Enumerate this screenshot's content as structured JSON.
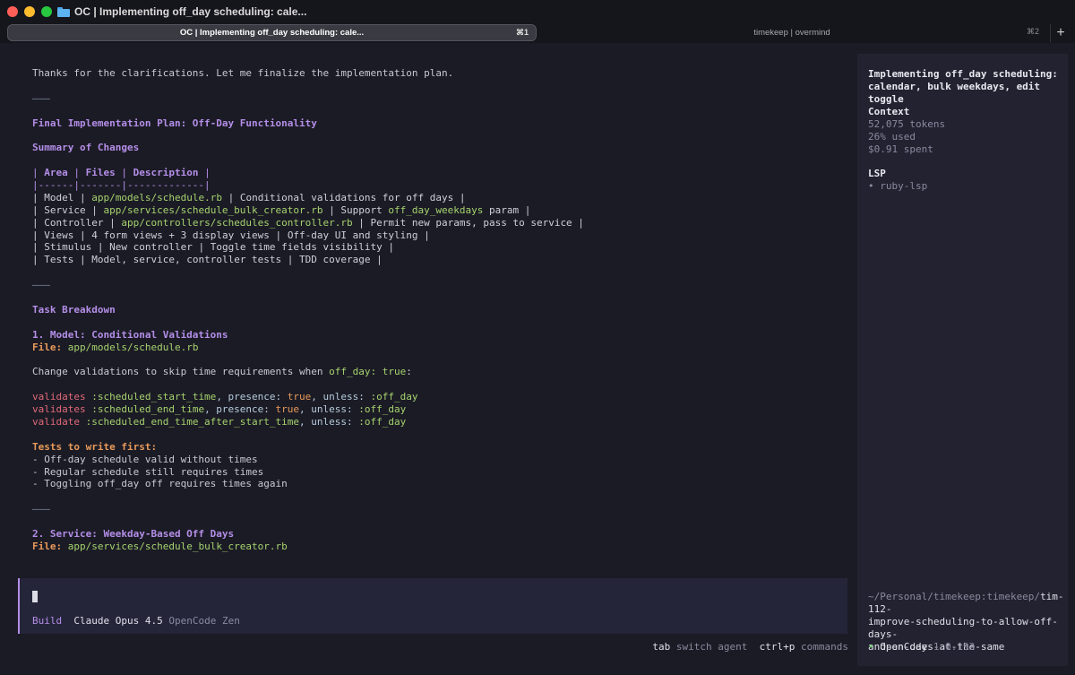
{
  "window": {
    "title": "OC | Implementing off_day scheduling: cale..."
  },
  "tabs": [
    {
      "label": "OC | Implementing off_day scheduling: cale...",
      "shortcut": "⌘1"
    },
    {
      "label": "timekeep | overmind",
      "shortcut": "⌘2"
    }
  ],
  "new_tab_label": "+",
  "conversation": {
    "intro": "Thanks for the clarifications. Let me finalize the implementation plan.",
    "rule": "———",
    "plan_title": "Final Implementation Plan: Off-Day Functionality",
    "summary_heading": "Summary of Changes",
    "table_header": {
      "pipe": "|",
      "cols": [
        "Area",
        "Files",
        "Description"
      ]
    },
    "table_separator": "|------|-------|-------------|",
    "table_rows": [
      {
        "area": "Model",
        "files": "app/models/schedule.rb",
        "desc_pre": "Conditional validations for off days",
        "desc_code": "",
        "desc_post": ""
      },
      {
        "area": "Service",
        "files": "app/services/schedule_bulk_creator.rb",
        "desc_pre": "Support ",
        "desc_code": "off_day_weekdays",
        "desc_post": " param"
      },
      {
        "area": "Controller",
        "files": "app/controllers/schedules_controller.rb",
        "desc_pre": "Permit new params, pass to service",
        "desc_code": "",
        "desc_post": ""
      },
      {
        "area": "Views",
        "files": "4 form views + 3 display views",
        "desc_pre": "Off-day UI and styling",
        "desc_code": "",
        "desc_post": ""
      },
      {
        "area": "Stimulus",
        "files": "New controller",
        "desc_pre": "Toggle time fields visibility",
        "desc_code": "",
        "desc_post": ""
      },
      {
        "area": "Tests",
        "files": "Model, service, controller tests",
        "desc_pre": "TDD coverage",
        "desc_code": "",
        "desc_post": ""
      }
    ],
    "task_heading": "Task Breakdown",
    "task1": {
      "title": "1. Model: Conditional Validations",
      "file_label": "File:",
      "file": "app/models/schedule.rb",
      "change_pre": "Change validations to skip time requirements when ",
      "change_code": "off_day: true",
      "change_post": ":",
      "code": [
        {
          "kw": "validates",
          "a": " :scheduled_start_time",
          "b": ", presence: ",
          "t": "true",
          "c": ", unless: ",
          "d": ":off_day"
        },
        {
          "kw": "validates",
          "a": " :scheduled_end_time",
          "b": ", presence: ",
          "t": "true",
          "c": ", unless: ",
          "d": ":off_day"
        },
        {
          "kw": "validate",
          "a": " :scheduled_end_time_after_start_time",
          "b": ", unless: ",
          "t": "",
          "c": "",
          "d": ":off_day"
        }
      ],
      "tests_heading": "Tests to write first:",
      "tests": [
        "- Off-day schedule valid without times",
        "- Regular schedule still requires times",
        "- Toggling off_day off requires times again"
      ]
    },
    "task2": {
      "title": "2. Service: Weekday-Based Off Days",
      "file_label": "File:",
      "file": "app/services/schedule_bulk_creator.rb"
    }
  },
  "input": {
    "mode": "Build",
    "model": "Claude Opus 4.5",
    "provider": "OpenCode Zen"
  },
  "hints": [
    {
      "key": "tab",
      "label": "switch agent"
    },
    {
      "key": "ctrl+p",
      "label": "commands"
    }
  ],
  "sidebar": {
    "title_line1": "Implementing off_day scheduling:",
    "title_line2": "calendar, bulk weekdays, edit toggle",
    "context_heading": "Context",
    "tokens": "52,075 tokens",
    "used": "26% used",
    "spent": "$0.91 spent",
    "lsp_heading": "LSP",
    "lsp_item": "ruby-lsp",
    "path_prefix": "~/Personal/timekeep:timekeep/",
    "branch_line1": "tim-112-",
    "path_line2": "improve-scheduling-to-allow-off-days-",
    "path_line3": "and-on-days-at-the-same",
    "app_name": "OpenCode",
    "version": "1.0.193",
    "status_color": "#6cc86c"
  }
}
